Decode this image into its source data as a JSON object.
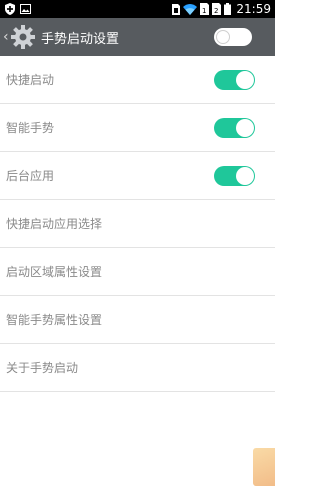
{
  "status_bar": {
    "time": "21:59",
    "icons": [
      "shield-icon",
      "image-icon",
      "sim-icon",
      "wifi-icon",
      "sim-card-1-icon",
      "sim-card-2-icon",
      "battery-icon"
    ]
  },
  "action_bar": {
    "title": "手势启动设置",
    "master_toggle_on": false
  },
  "settings": {
    "items": [
      {
        "label": "快捷启动",
        "toggle": true
      },
      {
        "label": "智能手势",
        "toggle": true
      },
      {
        "label": "后台应用",
        "toggle": true
      },
      {
        "label": "快捷启动应用选择"
      },
      {
        "label": "启动区域属性设置"
      },
      {
        "label": "智能手势属性设置"
      },
      {
        "label": "关于手势启动"
      }
    ]
  },
  "colors": {
    "accent": "#1fc79a",
    "action_bar": "#575b5f",
    "status_bar": "#000000"
  }
}
